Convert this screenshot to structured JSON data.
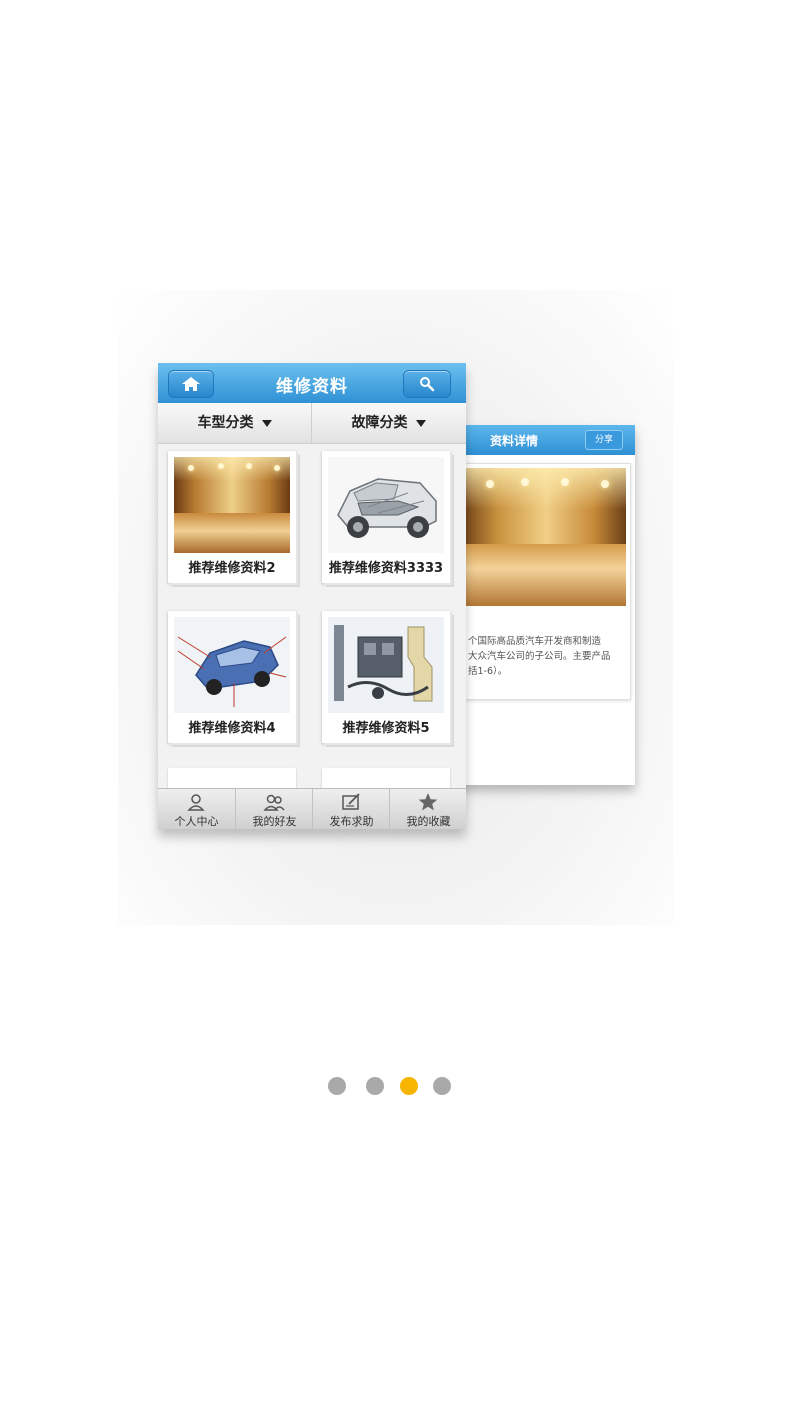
{
  "front": {
    "title": "维修资料",
    "filters": [
      {
        "label": "车型分类"
      },
      {
        "label": "故障分类"
      }
    ],
    "cards": [
      {
        "label": "推荐维修资料2"
      },
      {
        "label": "推荐维修资料3333"
      },
      {
        "label": "推荐维修资料4"
      },
      {
        "label": "推荐维修资料5"
      }
    ],
    "tabs": [
      {
        "label": "个人中心",
        "icon": "person-icon"
      },
      {
        "label": "我的好友",
        "icon": "friends-icon"
      },
      {
        "label": "发布求助",
        "icon": "post-help-icon"
      },
      {
        "label": "我的收藏",
        "icon": "star-icon"
      }
    ]
  },
  "back": {
    "title": "资料详情",
    "share_label": "分享",
    "text_lines": [
      "个国际高品质汽车开发商和制造",
      "大众汽车公司的子公司。主要产品",
      "括1-6）。"
    ]
  },
  "pager": {
    "total": 4,
    "active_index": 2,
    "active_color": "#f7b500",
    "inactive_color": "#a9a9a9"
  }
}
